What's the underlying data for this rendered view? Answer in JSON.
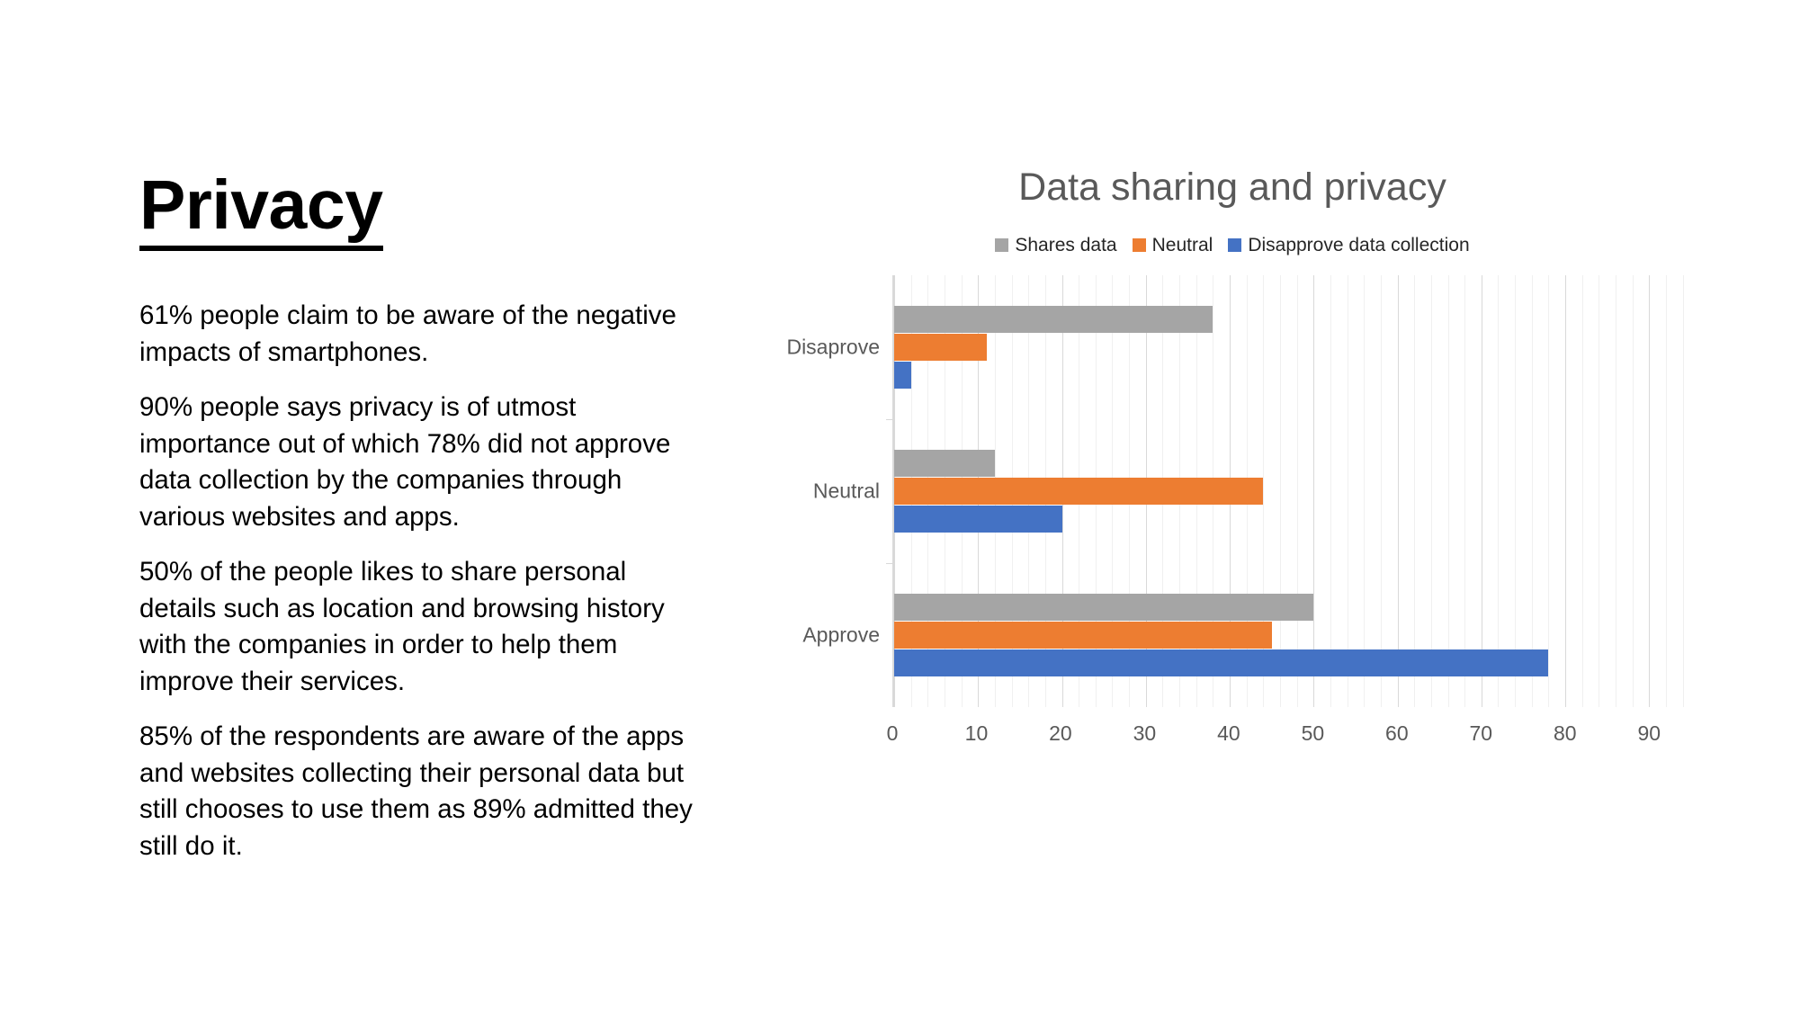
{
  "slide": {
    "title": "Privacy",
    "paragraphs": [
      "61% people claim to be aware of the negative impacts of smartphones.",
      "90% people says privacy is of utmost importance out of which 78% did not approve data collection by the companies through various websites and apps.",
      "50% of the people likes to share personal details such as location and browsing history with the companies in order to help them improve their services.",
      "85% of the respondents are aware of the apps and websites collecting their personal data but still chooses to use them as 89% admitted they still do it."
    ]
  },
  "chart_data": {
    "type": "bar",
    "orientation": "horizontal",
    "title": "Data sharing and privacy",
    "xlabel": "",
    "ylabel": "",
    "categories": [
      "Disaprove",
      "Neutral",
      "Approve"
    ],
    "series": [
      {
        "name": "Shares data",
        "color": "#A5A5A5",
        "values": [
          38,
          12,
          50
        ]
      },
      {
        "name": "Neutral",
        "color": "#ED7D31",
        "values": [
          11,
          44,
          45
        ]
      },
      {
        "name": "Disapprove data collection",
        "color": "#4472C4",
        "values": [
          2,
          20,
          78
        ]
      }
    ],
    "xlim": [
      0,
      95
    ],
    "xticks": [
      0,
      10,
      20,
      30,
      40,
      50,
      60,
      70,
      80,
      90
    ],
    "xtick_labels": [
      "0",
      "10",
      "20",
      "30",
      "40",
      "50",
      "60",
      "70",
      "80",
      "90"
    ],
    "minor_tick_step": 2,
    "grid": true,
    "legend_position": "top"
  }
}
